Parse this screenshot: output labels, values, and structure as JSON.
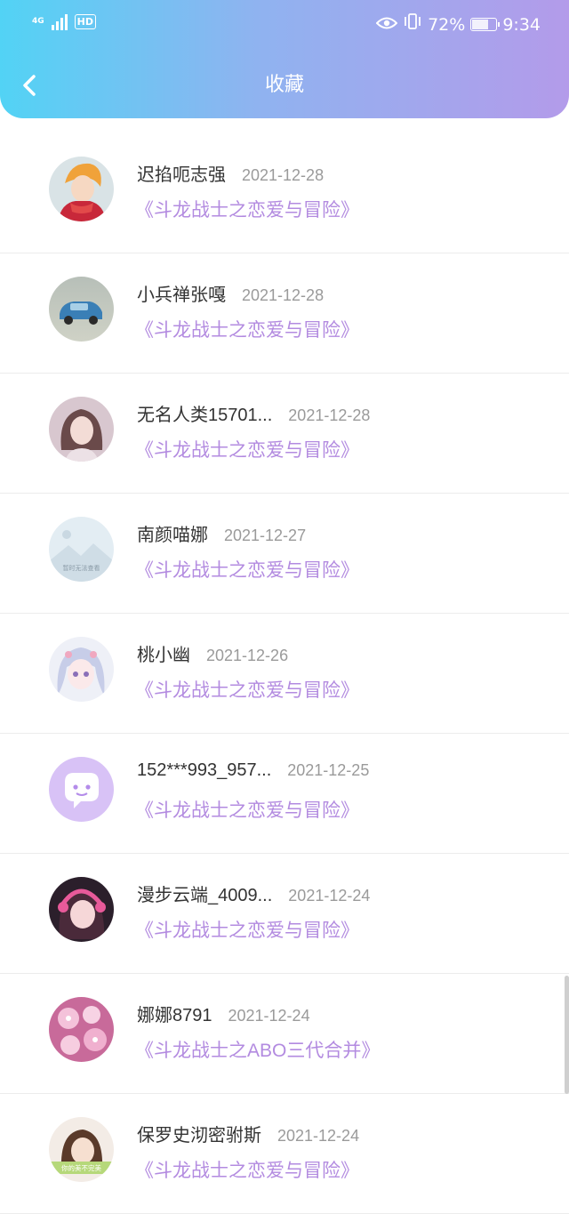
{
  "status_bar": {
    "network": "4G",
    "hd": "HD",
    "battery": "72%",
    "battery_level": 0.72,
    "time": "9:34",
    "icons": [
      "eye-icon",
      "vibrate-icon",
      "battery-icon"
    ]
  },
  "header": {
    "title": "收藏",
    "back_icon": "chevron-left-icon",
    "gradient": [
      "#52d3f5",
      "#b39bea"
    ]
  },
  "colors": {
    "book_title": "#b38be0",
    "date": "#9a9a9a"
  },
  "items": [
    {
      "name": "迟掐呃志强",
      "date": "2021-12-28",
      "book": "《斗龙战士之恋爱与冒险》",
      "avatar": "anime-boy-avatar"
    },
    {
      "name": "小兵禅张嘎",
      "date": "2021-12-28",
      "book": "《斗龙战士之恋爱与冒险》",
      "avatar": "toy-car-avatar"
    },
    {
      "name": "无名人类15701...",
      "date": "2021-12-28",
      "book": "《斗龙战士之恋爱与冒险》",
      "avatar": "girl-photo-avatar"
    },
    {
      "name": "南颜喵娜",
      "date": "2021-12-27",
      "book": "《斗龙战士之恋爱与冒险》",
      "avatar": "placeholder-avatar",
      "avatar_text": "暂时无法查看"
    },
    {
      "name": "桃小幽",
      "date": "2021-12-26",
      "book": "《斗龙战士之恋爱与冒险》",
      "avatar": "anime-girl-avatar"
    },
    {
      "name": "152***993_957...",
      "date": "2021-12-25",
      "book": "《斗龙战士之恋爱与冒险》",
      "avatar": "default-chat-avatar"
    },
    {
      "name": "漫步云端_4009...",
      "date": "2021-12-24",
      "book": "《斗龙战士之恋爱与冒险》",
      "avatar": "headphone-girl-avatar"
    },
    {
      "name": "娜娜8791",
      "date": "2021-12-24",
      "book": "《斗龙战士之ABO三代合并》",
      "avatar": "pink-flowers-avatar"
    },
    {
      "name": "保罗史沏密驸斯",
      "date": "2021-12-24",
      "book": "《斗龙战士之恋爱与冒险》",
      "avatar": "girl-card-avatar",
      "avatar_text": "你的美不完美"
    }
  ]
}
